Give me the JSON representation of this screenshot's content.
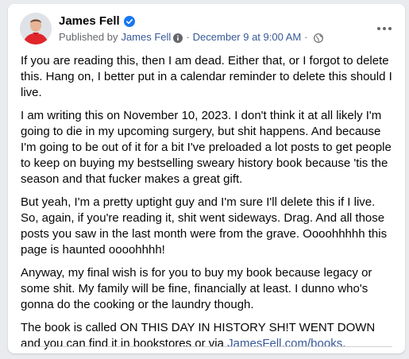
{
  "post": {
    "author": "James Fell",
    "published_by_prefix": "Published by",
    "published_by_name": "James Fell",
    "date": "December 9 at 9:00 AM",
    "more_icon": "more-horizontal-icon",
    "verified_icon": "verified-badge-icon",
    "audience_icon": "globe-icon",
    "info_icon": "info-circle-icon",
    "paragraphs": [
      "If you are reading this, then I am dead. Either that, or I forgot to delete this. Hang on, I better put in a calendar reminder to delete this should I live.",
      "I am writing this on November 10, 2023. I don't think it at all likely I'm going to die in my upcoming surgery, but shit happens. And because I'm going to be out of it for a bit I've preloaded a lot posts to get people to keep on buying my bestselling sweary history book because 'tis the season and that fucker makes a great gift.",
      "But yeah, I'm a pretty uptight guy and I'm sure I'll delete this if I live. So, again, if you're reading it, shit went sideways. Drag. And all those posts you saw in the last month were from the grave. Oooohhhhh this page is haunted oooohhhh!",
      "Anyway, my final wish is for you to buy my book because legacy or some shit. My family will be fine, financially at least. I dunno who's gonna do the cooking or the laundry though."
    ],
    "last_paragraph_prefix": "The book is called ON THIS DAY IN HISTORY SH!T WENT DOWN and you can find it in bookstores or via ",
    "last_paragraph_link": "JamesFell.com/books",
    "last_paragraph_suffix": "."
  },
  "colors": {
    "link": "#385898",
    "verified": "#1877f2",
    "secondary_text": "#65676b",
    "avatar_shirt": "#e0262b"
  }
}
